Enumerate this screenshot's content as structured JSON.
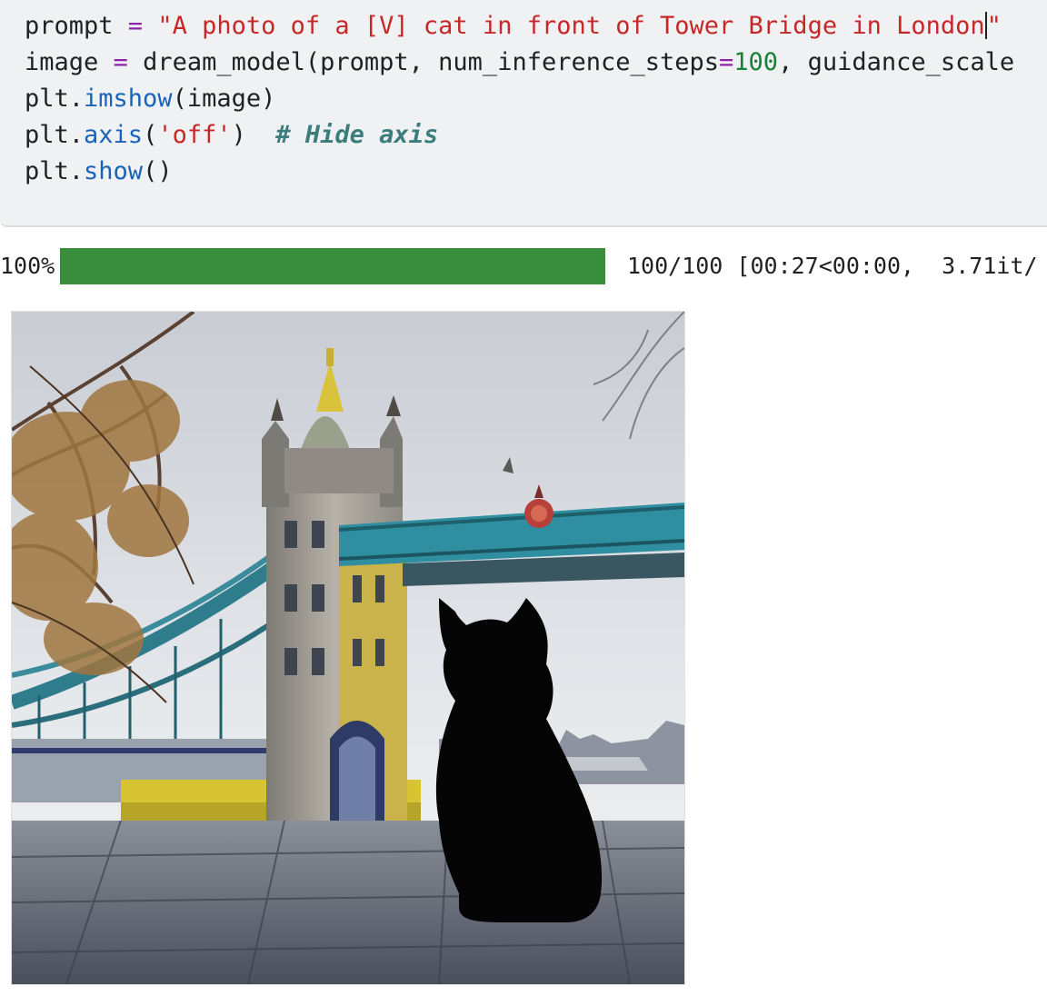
{
  "code": {
    "line1": {
      "var": "prompt",
      "op": " = ",
      "str_open": "\"A photo of a [V] cat in front of Tower Bridge in London",
      "str_close": "\""
    },
    "line2": {
      "var": "image",
      "op": " = ",
      "call": "dream_model(prompt, num_inference_steps",
      "eq": "=",
      "num": "100",
      "rest": ", guidance_scale"
    },
    "line3": {
      "obj": "plt.",
      "fn": "imshow",
      "args": "(image)"
    },
    "line4": {
      "obj": "plt.",
      "fn": "axis",
      "open": "(",
      "str": "'off'",
      "close": ")  ",
      "comment": "# Hide axis"
    },
    "line5": {
      "obj": "plt.",
      "fn": "show",
      "args": "()"
    }
  },
  "progress": {
    "percent_label": "100%",
    "fraction": 1.0,
    "stats": "100/100 [00:27<00:00,  3.71it/",
    "color": "#388e3c"
  },
  "output_image": {
    "subject": "black cat silhouette in front of Tower Bridge, London"
  }
}
